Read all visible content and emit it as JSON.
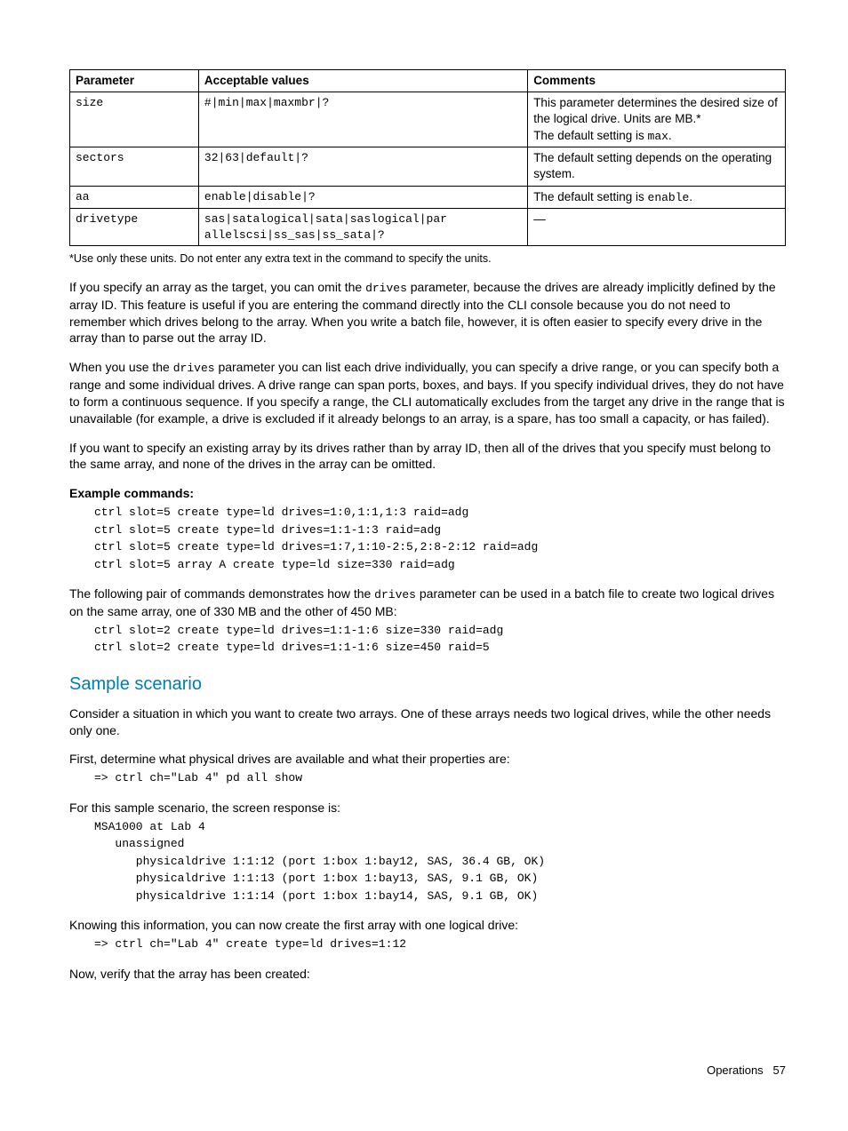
{
  "table": {
    "headers": [
      "Parameter",
      "Acceptable values",
      "Comments"
    ],
    "rows": [
      {
        "param": "size",
        "values": "#|min|max|maxmbr|?",
        "comment_plain": "This parameter determines the desired size of the logical drive. Units are MB.*\nThe default setting is ",
        "comment_code": "max",
        "comment_tail": "."
      },
      {
        "param": "sectors",
        "values": "32|63|default|?",
        "comment_plain": "The default setting depends on the operating system."
      },
      {
        "param": "aa",
        "values": "enable|disable|?",
        "comment_plain": "The default setting is ",
        "comment_code": "enable",
        "comment_tail": "."
      },
      {
        "param": "drivetype",
        "values": "sas|satalogical|sata|saslogical|par allelscsi|ss_sas|ss_sata|?",
        "comment_plain": "—"
      }
    ]
  },
  "footnote": "*Use only these units. Do not enter any extra text in the command to specify the units.",
  "para1a": "If you specify an array as the target, you can omit the ",
  "para1code": "drives",
  "para1b": " parameter, because the drives are already implicitly defined by the array ID. This feature is useful if you are entering the command directly into the CLI console because you do not need to remember which drives belong to the array. When you write a batch file, however, it is often easier to specify every drive in the array than to parse out the array ID.",
  "para2a": "When you use the ",
  "para2code": "drives",
  "para2b": " parameter you can list each drive individually, you can specify a drive range, or you can specify both a range and some individual drives. A drive range can span ports, boxes, and bays. If you specify individual drives, they do not have to form a continuous sequence. If you specify a range, the CLI automatically excludes from the target any drive in the range that is unavailable (for example, a drive is excluded if it already belongs to an array, is a spare, has too small a capacity, or has failed).",
  "para3": "If you want to specify an existing array by its drives rather than by array ID, then all of the drives that you specify must belong to the same array, and none of the drives in the array can be omitted.",
  "example_heading": "Example commands:",
  "example_block1": "ctrl slot=5 create type=ld drives=1:0,1:1,1:3 raid=adg\nctrl slot=5 create type=ld drives=1:1-1:3 raid=adg\nctrl slot=5 create type=ld drives=1:7,1:10-2:5,2:8-2:12 raid=adg\nctrl slot=5 array A create type=ld size=330 raid=adg",
  "para4a": "The following pair of commands demonstrates how the ",
  "para4code": "drives",
  "para4b": " parameter can be used in a batch file to create two logical drives on the same array, one of 330 MB and the other of 450 MB:",
  "example_block2": "ctrl slot=2 create type=ld drives=1:1-1:6 size=330 raid=adg\nctrl slot=2 create type=ld drives=1:1-1:6 size=450 raid=5",
  "h2": "Sample scenario",
  "para5": "Consider a situation in which you want to create two arrays. One of these arrays needs two logical drives, while the other needs only one.",
  "para6": "First, determine what physical drives are available and what their properties are:",
  "code6": "=> ctrl ch=\"Lab 4\" pd all show",
  "para7": "For this sample scenario, the screen response is:",
  "code7": "MSA1000 at Lab 4\n   unassigned\n      physicaldrive 1:1:12 (port 1:box 1:bay12, SAS, 36.4 GB, OK)\n      physicaldrive 1:1:13 (port 1:box 1:bay13, SAS, 9.1 GB, OK)\n      physicaldrive 1:1:14 (port 1:box 1:bay14, SAS, 9.1 GB, OK)",
  "para8": "Knowing this information, you can now create the first array with one logical drive:",
  "code8": "=> ctrl ch=\"Lab 4\" create type=ld drives=1:12",
  "para9": "Now, verify that the array has been created:",
  "footer_label": "Operations",
  "footer_page": "57"
}
